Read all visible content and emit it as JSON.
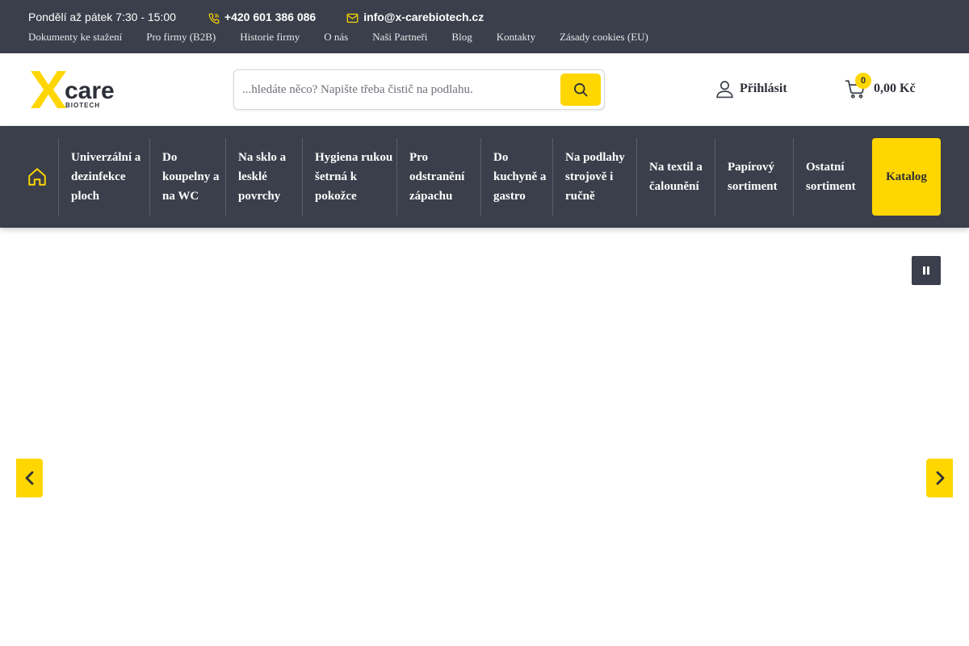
{
  "topbar": {
    "hours": "Pondělí až pátek 7:30 - 15:00",
    "phone": "+420 601 386 086",
    "email": "info@x-carebiotech.cz",
    "links": [
      "Dokumenty ke stažení",
      "Pro firmy (B2B)",
      "Historie firmy",
      "O nás",
      "Naši Partneři",
      "Blog",
      "Kontakty",
      "Zásady cookies (EU)"
    ]
  },
  "logo": {
    "main": "Xcare",
    "sub": "BIOTECH"
  },
  "search": {
    "placeholder": "...hledáte něco? Napište třeba čistič na podlahu."
  },
  "account": {
    "login_label": "Přihlásit"
  },
  "cart": {
    "count": "0",
    "total": "0,00 Kč"
  },
  "categories": [
    "Univerzální a dezinfekce ploch",
    "Do koupelny a na WC",
    "Na sklo a lesklé povrchy",
    "Hygiena rukou šetrná k pokožce",
    "Pro odstranění zápachu",
    "Do kuchyně a gastro",
    "Na podlahy strojově i ručně",
    "Na textil a čalounění",
    "Papírový sortiment",
    "Ostatní sortiment"
  ],
  "catalog_label": "Katalog",
  "colors": {
    "dark": "#3a3f4b",
    "accent": "#ffd600",
    "text": "#2d3038"
  },
  "icons": {
    "phone": "phone-icon",
    "mail": "mail-icon",
    "search": "search-icon",
    "user": "user-icon",
    "cart": "cart-icon",
    "home": "home-icon",
    "pause": "pause-icon",
    "prev": "chevron-left-icon",
    "next": "chevron-right-icon"
  }
}
